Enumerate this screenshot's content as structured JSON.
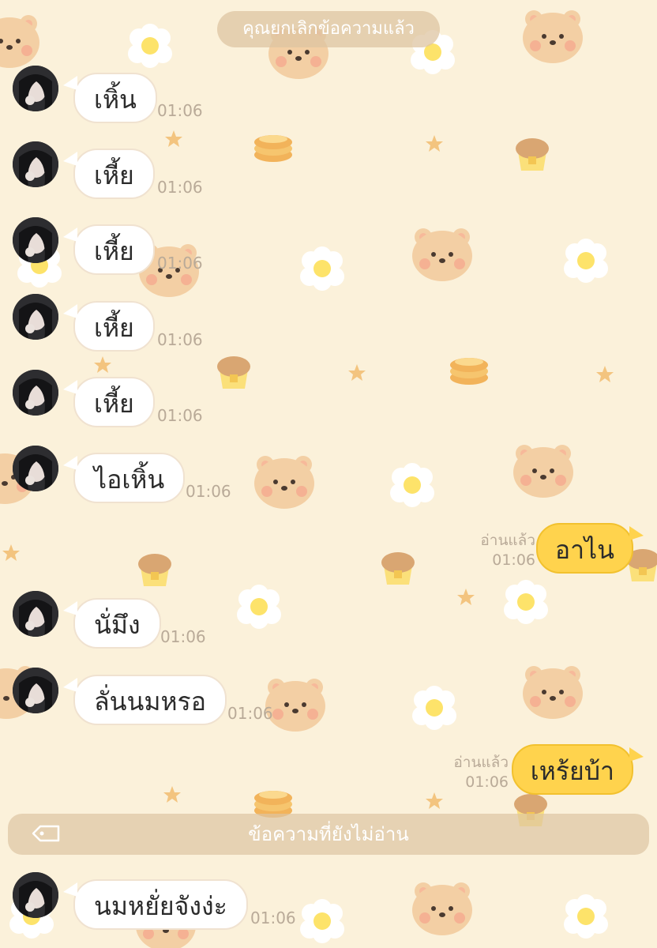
{
  "system_notice": "คุณยกเลิกข้อความแล้ว",
  "unread_divider": "ข้อความที่ยังไม่อ่าน",
  "colors": {
    "background": "#fbf1da",
    "incoming_bubble": "#ffffff",
    "outgoing_bubble": "#ffd34d",
    "meta_text": "#b9aa98"
  },
  "icons": {
    "divider_icon": "tag-icon",
    "background_pattern": [
      "bear-face-icon",
      "fried-egg-icon",
      "pancake-icon",
      "muffin-icon",
      "star-icon"
    ]
  },
  "messages": [
    {
      "direction": "in",
      "text": "เหิ้น",
      "time": "01:06"
    },
    {
      "direction": "in",
      "text": "เหี้ย",
      "time": "01:06"
    },
    {
      "direction": "in",
      "text": "เหี้ย",
      "time": "01:06"
    },
    {
      "direction": "in",
      "text": "เหี้ย",
      "time": "01:06"
    },
    {
      "direction": "in",
      "text": "เหี้ย",
      "time": "01:06"
    },
    {
      "direction": "in",
      "text": "ไอเหิ้น",
      "time": "01:06"
    },
    {
      "direction": "out",
      "text": "อาไน",
      "read": "อ่านแล้ว",
      "time": "01:06"
    },
    {
      "direction": "in",
      "text": "นั่มึง",
      "time": "01:06"
    },
    {
      "direction": "in",
      "text": "ลั่นนมหรอ",
      "time": "01:06"
    },
    {
      "direction": "out",
      "text": "เหร้ยบ้า",
      "read": "อ่านแล้ว",
      "time": "01:06"
    },
    {
      "direction": "in",
      "text": "นมหยั่ยจังง่ะ",
      "time": "01:06"
    }
  ]
}
